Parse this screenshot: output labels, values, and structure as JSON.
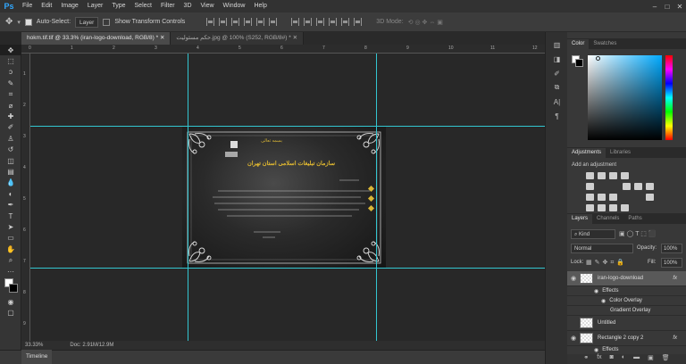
{
  "app": {
    "logo": "Ps"
  },
  "menu": [
    "File",
    "Edit",
    "Image",
    "Layer",
    "Type",
    "Select",
    "Filter",
    "3D",
    "View",
    "Window",
    "Help"
  ],
  "window_controls": {
    "minimize": "–",
    "maximize": "□",
    "close": "✕"
  },
  "options": {
    "auto_select_label": "Auto-Select:",
    "auto_select_value": "Layer",
    "transform_label": "Show Transform Controls",
    "mode_label": "3D Mode:"
  },
  "tabs": [
    {
      "label": "hokm.tif.tif @ 33.3% (iran-logo-download, RGB/8) *",
      "active": true
    },
    {
      "label": "حکم مسئولیت.jpg @ 100% (S252, RGB/8#) *",
      "active": false
    }
  ],
  "ruler": {
    "top": [
      "0",
      "1",
      "2",
      "3",
      "4",
      "5",
      "6",
      "7",
      "8",
      "9",
      "10",
      "11",
      "12"
    ],
    "left": [
      "1",
      "2",
      "3",
      "4",
      "5",
      "6",
      "7",
      "8",
      "9"
    ]
  },
  "document": {
    "title_line1": "سازمان تبلیغات اسلامی استان تهران",
    "header_script": "بسمه تعالی"
  },
  "status": {
    "zoom": "33.33%",
    "doc_size": "Doc: 2.91M/12.9M"
  },
  "timeline": {
    "label": "Timeline"
  },
  "panels": {
    "color_tabs": [
      "Color",
      "Swatches"
    ],
    "adjust_tabs": [
      "Adjustments",
      "Libraries"
    ],
    "adjust_hint": "Add an adjustment",
    "layer_tabs": [
      "Layers",
      "Channels",
      "Paths"
    ],
    "kind": "Kind",
    "blend_mode": "Normal",
    "opacity_label": "Opacity:",
    "opacity": "100%",
    "lock_label": "Lock:",
    "fill_label": "Fill:",
    "fill": "100%"
  },
  "layers": [
    {
      "name": "iran-logo-download",
      "fx": "fx",
      "selected": true
    },
    {
      "name": "Effects",
      "sub": true
    },
    {
      "name": "Color Overlay",
      "sub": true
    },
    {
      "name": "Gradient Overlay",
      "sub": true
    },
    {
      "name": "Untitled"
    },
    {
      "name": "Rectangle 2 copy 2",
      "fx": "fx"
    },
    {
      "name": "Effects",
      "sub": true
    }
  ],
  "colors": {
    "guide": "#33c6d1",
    "accent": "#31a8ff",
    "gold": "#d9b636"
  }
}
